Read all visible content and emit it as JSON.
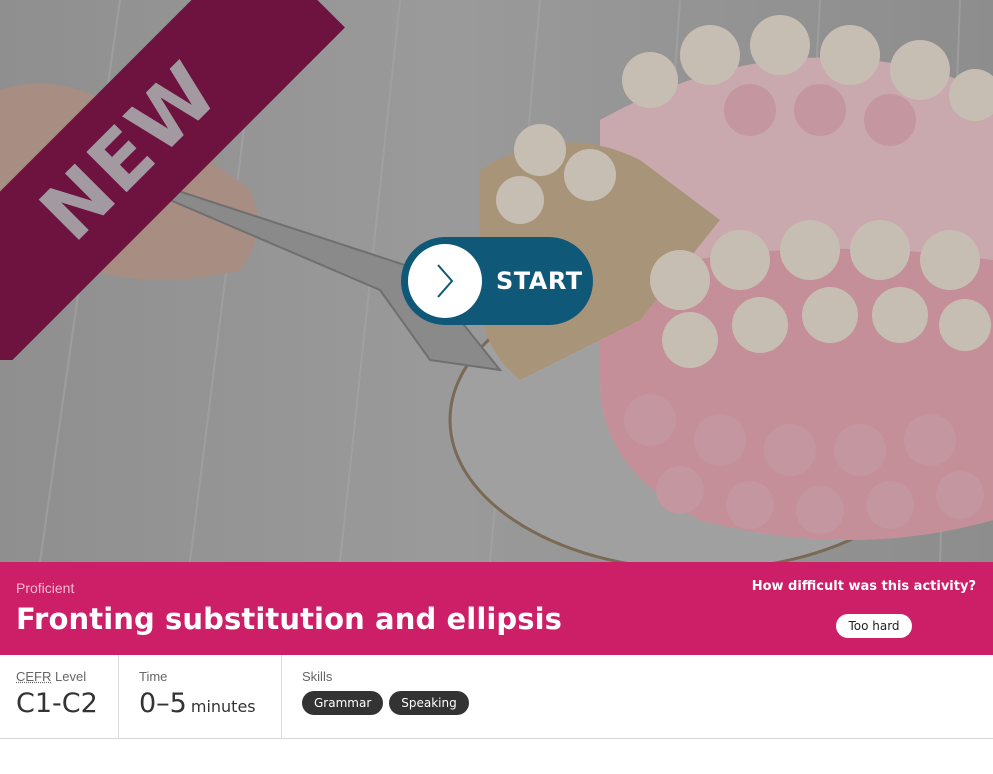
{
  "hero": {
    "ribbon_text": "NEW",
    "start_label": "START",
    "image_subject": "cake-photo"
  },
  "activity": {
    "level": "Proficient",
    "title": "Fronting substitution and ellipsis",
    "difficulty_question": "How difficult was this activity?",
    "difficulty_button": "Too hard"
  },
  "details": {
    "cefr_abbr": "CEFR",
    "cefr_suffix": " Level",
    "cefr_value": "C1-C2",
    "time_label": "Time",
    "time_value": "0–5",
    "time_unit": "minutes",
    "skills_label": "Skills",
    "skills": [
      "Grammar",
      "Speaking"
    ]
  },
  "colors": {
    "ribbon": "#6e1240",
    "start_button": "#0f5877",
    "info_bar": "#cc1f68",
    "tag": "#333333"
  }
}
